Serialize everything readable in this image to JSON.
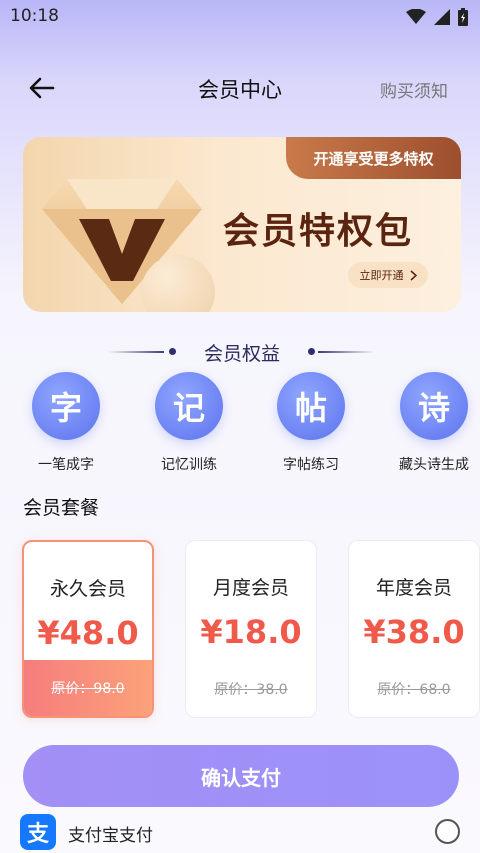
{
  "status_bar": {
    "time": "10:18"
  },
  "nav": {
    "title": "会员中心",
    "right_link": "购买须知"
  },
  "banner": {
    "tag": "开通享受更多特权",
    "title": "会员特权包",
    "cta": "立即开通"
  },
  "benefits_section": {
    "title": "会员权益",
    "items": [
      {
        "glyph": "字",
        "label": "一笔成字"
      },
      {
        "glyph": "记",
        "label": "记忆训练"
      },
      {
        "glyph": "帖",
        "label": "字帖练习"
      },
      {
        "glyph": "诗",
        "label": "藏头诗生成"
      }
    ]
  },
  "plans_section": {
    "title": "会员套餐",
    "plans": [
      {
        "name": "永久会员",
        "price": "¥48.0",
        "original": "原价：98.0",
        "selected": true
      },
      {
        "name": "月度会员",
        "price": "¥18.0",
        "original": "原价：38.0",
        "selected": false
      },
      {
        "name": "年度会员",
        "price": "¥38.0",
        "original": "原价：68.0",
        "selected": false
      }
    ]
  },
  "confirm_button": "确认支付",
  "payment": {
    "method_label": "支付宝支付",
    "icon_glyph": "支",
    "checked": false
  },
  "colors": {
    "accent_purple": "#9b92f9",
    "price_red": "#f05a4b",
    "benefit_blue": "#5d73ee",
    "alipay_blue": "#1677ff"
  }
}
